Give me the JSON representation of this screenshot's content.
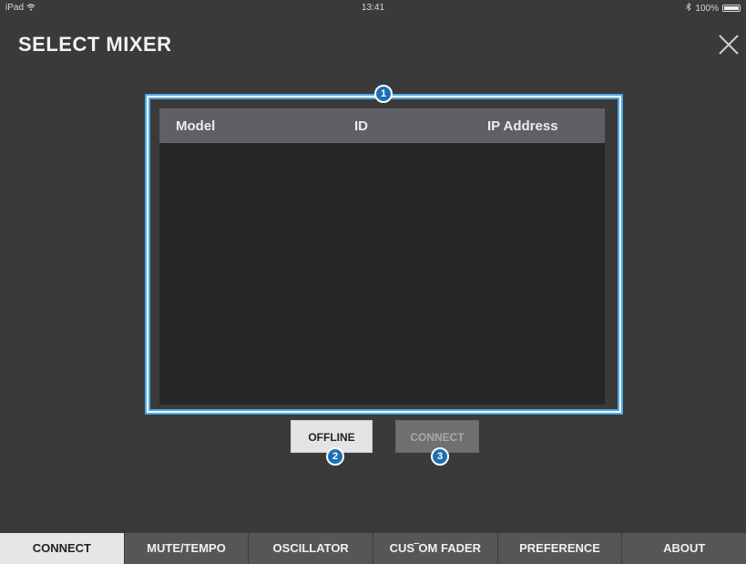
{
  "status_bar": {
    "device": "iPad",
    "time": "13:41",
    "battery": "100%"
  },
  "header": {
    "title": "SELECT MIXER"
  },
  "table": {
    "columns": [
      "Model",
      "ID",
      "IP Address"
    ],
    "rows": []
  },
  "callouts": [
    "1",
    "2",
    "3"
  ],
  "buttons": {
    "offline": "OFFLINE",
    "connect": "CONNECT"
  },
  "tabs": [
    {
      "label": "CONNECT",
      "active": true
    },
    {
      "label": "MUTE/TEMPO",
      "active": false
    },
    {
      "label": "OSCILLATOR",
      "active": false
    },
    {
      "label": "CUS‾OM FADER",
      "active": false
    },
    {
      "label": "PREFERENCE",
      "active": false
    },
    {
      "label": "ABOUT",
      "active": false
    }
  ],
  "icons": {
    "wifi": "wifi-icon",
    "bluetooth": "bluetooth-icon",
    "battery": "battery-icon",
    "close": "close-icon"
  },
  "colors": {
    "background": "#3a3a3b",
    "accent": "#4aa8e0",
    "callout": "#1c6fb4",
    "tab_active": "#e6e6e8"
  }
}
